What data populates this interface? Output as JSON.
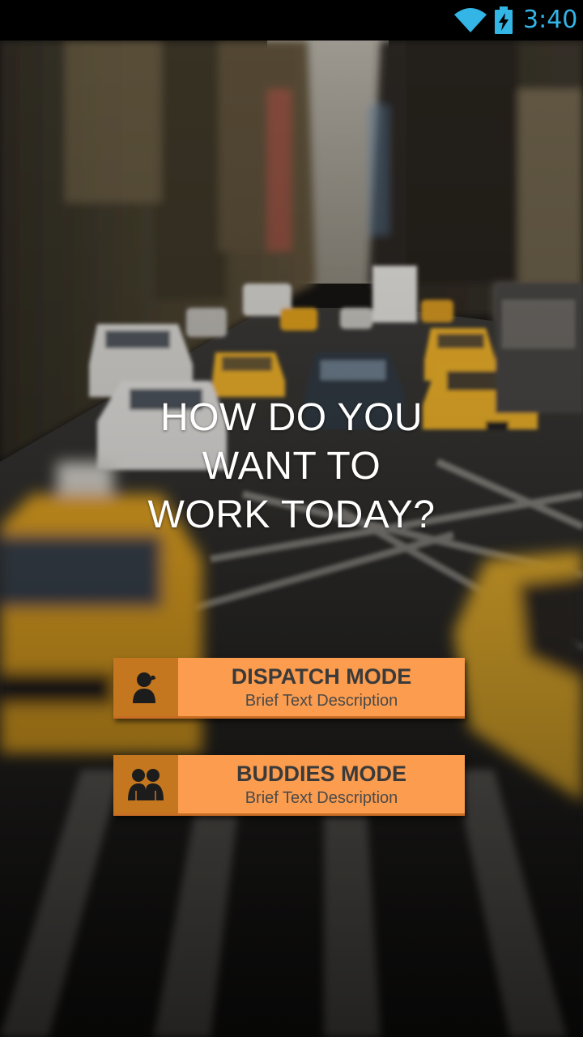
{
  "status_bar": {
    "time": "3:40",
    "icons": [
      "wifi-icon",
      "battery-charging-icon"
    ],
    "accent_color": "#33b5e5"
  },
  "headline": {
    "line1": "HOW DO YOU",
    "line2": "WANT TO",
    "line3": "WORK TODAY?"
  },
  "modes": [
    {
      "title": "DISPATCH MODE",
      "description": "Brief Text Description",
      "icon": "person-icon"
    },
    {
      "title": "BUDDIES MODE",
      "description": "Brief Text Description",
      "icon": "group-icon"
    }
  ],
  "colors": {
    "button_background": "#fb9c4f",
    "icon_box_background": "#c4771e",
    "button_text": "#3a3a3a",
    "headline_text": "#ffffff"
  },
  "background_image": "blurred-city-street-with-yellow-taxis"
}
